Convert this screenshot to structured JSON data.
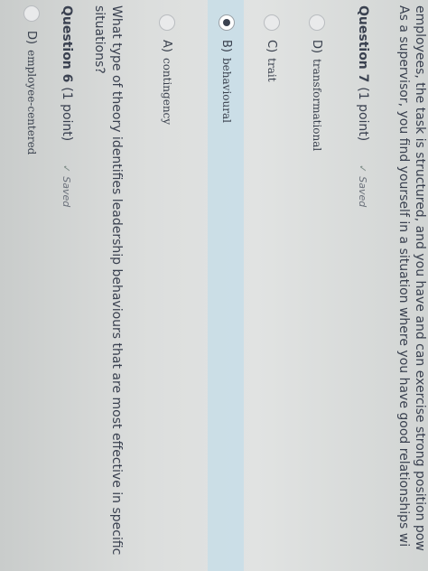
{
  "q5": {
    "options": [
      {
        "letter": "D)",
        "text": "employee-centered",
        "selected": false
      }
    ]
  },
  "q6": {
    "title": "Question 6",
    "points": "(1 point)",
    "status": "Saved",
    "check_icon": "check-icon",
    "text": "What type of theory identifies leadership behaviours that are most effective in specific situations?",
    "options": [
      {
        "letter": "A)",
        "text": "contingency",
        "selected": false
      },
      {
        "letter": "B)",
        "text": "behavioural",
        "selected": true
      },
      {
        "letter": "C)",
        "text": "trait",
        "selected": false
      },
      {
        "letter": "D)",
        "text": "transformational",
        "selected": false
      }
    ]
  },
  "q7": {
    "title": "Question 7",
    "points": "(1 point)",
    "status": "Saved",
    "check_icon": "check-icon",
    "text_line1": "As a supervisor, you find yourself in a situation where you have good relationships wi",
    "text_line2": "employees, the task is structured, and you have and can exercise strong position pow"
  },
  "colors": {
    "selected_band": "#c4dce8",
    "text": "#3a4150",
    "saved": "#6b717b"
  }
}
